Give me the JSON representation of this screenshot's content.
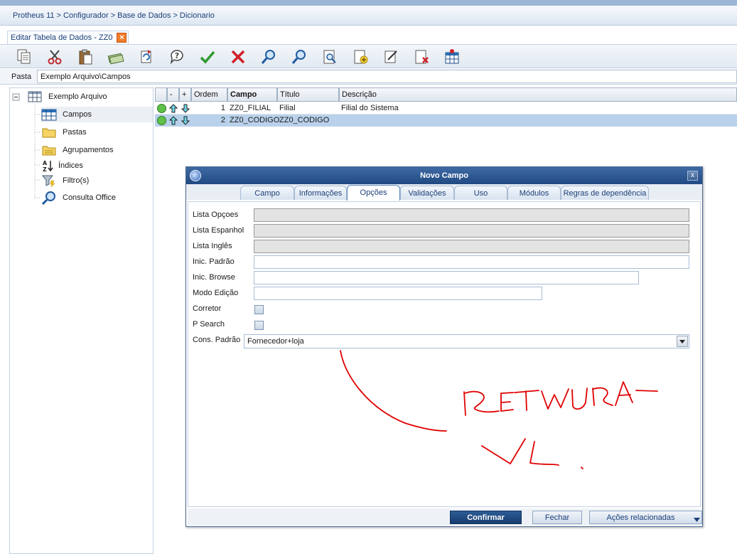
{
  "breadcrumb": "Protheus 11 > Configurador > Base de Dados > Dicionario",
  "doc_tab": {
    "label": "Editar Tabela de Dados - ZZ0",
    "close": "×"
  },
  "toolbar": {
    "icons": [
      "copy-icon",
      "cut-icon",
      "paste-icon",
      "money-icon",
      "refresh-icon",
      "help-icon",
      "confirm-check-icon",
      "cancel-x-icon",
      "search-icon",
      "search-next-icon",
      "preview-icon",
      "add-document-icon",
      "edit-document-icon",
      "delete-document-icon",
      "table-icon"
    ]
  },
  "path_bar": {
    "label": "Pasta",
    "value": "Exemplo Arquivo\\Campos"
  },
  "tree": {
    "root": "Exemplo Arquivo",
    "items": [
      "Campos",
      "Pastas",
      "Agrupamentos",
      "Índices",
      "Filtro(s)",
      "Consulta Office"
    ]
  },
  "grid": {
    "headers": {
      "minus": "-",
      "plus": "+",
      "ordem": "Ordem",
      "campo": "Campo",
      "titulo": "Título",
      "descricao": "Descrição"
    },
    "rows": [
      {
        "ordem": "1",
        "campo": "ZZ0_FILIAL",
        "titulo": "Filial",
        "descricao": "Filial do Sistema"
      },
      {
        "ordem": "2",
        "campo": "ZZ0_CODIGO",
        "titulo": "ZZ0_CODIGO",
        "descricao": ""
      }
    ]
  },
  "dialog": {
    "title": "Novo Campo",
    "close": "x",
    "tabs": [
      "Campo",
      "Informações",
      "Opções",
      "Validações",
      "Uso",
      "Módulos",
      "Regras de dependência"
    ],
    "active_tab": "Opções",
    "fields": {
      "lista_opcoes": "Lista Opçoes",
      "lista_espanhol": "Lista Espanhol",
      "lista_ingles": "Lista Inglês",
      "inic_padrao": "Inic. Padrão",
      "inic_browse": "Inic. Browse",
      "modo_edicao": "Modo Edição",
      "corretor": "Corretor",
      "p_search": "P Search",
      "cons_padrao": "Cons. Padrão"
    },
    "cons_padrao_value": "Fornecedor+loja",
    "buttons": {
      "confirmar": "Confirmar",
      "fechar": "Fechar",
      "acoes": "Ações relacionadas"
    }
  },
  "colors": {
    "accent": "#1c3f78",
    "annotation": "#e00000",
    "title_bar": "#214a83"
  }
}
